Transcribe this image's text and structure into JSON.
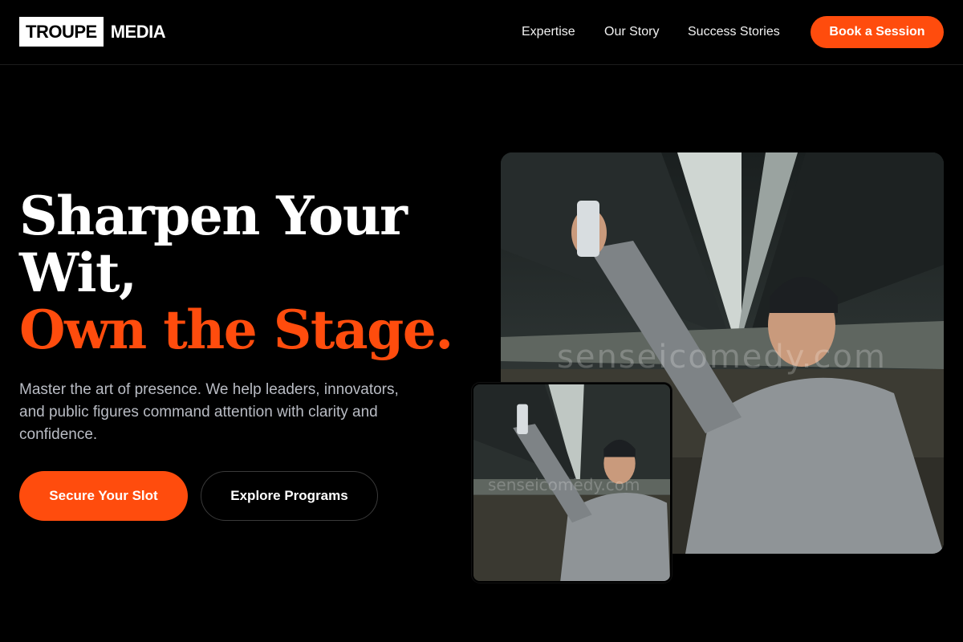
{
  "brand": {
    "logo_box": "TROUPE",
    "logo_text": "MEDIA"
  },
  "nav": {
    "links": [
      "Expertise",
      "Our Story",
      "Success Stories"
    ],
    "cta": "Book a Session"
  },
  "hero": {
    "title_line1": "Sharpen Your Wit,",
    "title_accent": "Own the Stage.",
    "subtitle": "Master the art of presence. We help leaders, innovators, and public figures command attention with clarity and confidence.",
    "primary_cta": "Secure Your Slot",
    "secondary_cta": "Explore Programs"
  },
  "images": {
    "watermark": "senseicomedy.com"
  },
  "colors": {
    "accent": "#ff4c0d",
    "background": "#000000",
    "subtitle": "#b9bcc4"
  }
}
